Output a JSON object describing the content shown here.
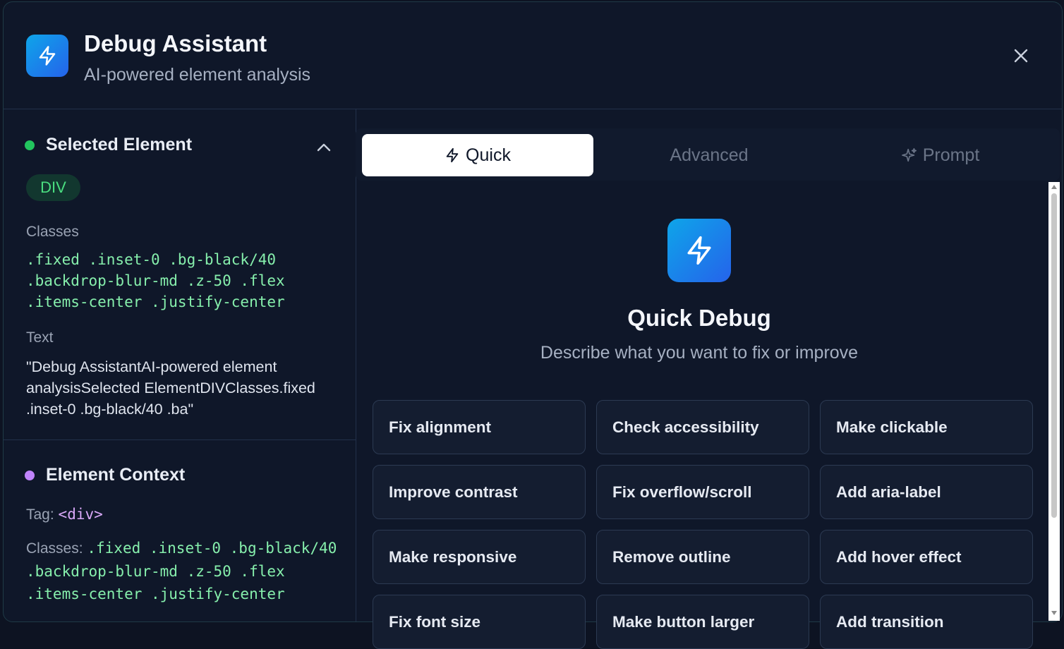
{
  "header": {
    "title": "Debug Assistant",
    "subtitle": "AI-powered element analysis",
    "icon": "lightning-icon",
    "close_icon": "close-icon"
  },
  "selected_element": {
    "title": "Selected Element",
    "dot_color": "#22c55e",
    "tag_badge": "DIV",
    "classes_label": "Classes",
    "classes": [
      ".fixed .inset-0 .bg-black/40",
      ".backdrop-blur-md .z-50 .flex",
      ".items-center .justify-center"
    ],
    "text_label": "Text",
    "text_value": "\"Debug AssistantAI-powered element analysisSelected ElementDIVClasses.fixed .inset-0 .bg-black/40 .ba\""
  },
  "element_context": {
    "title": "Element Context",
    "dot_color": "#c084fc",
    "tag_label": "Tag:",
    "tag_value": "<div>",
    "classes_label": "Classes:",
    "classes_first": ".fixed .inset-0 .bg-black/40",
    "classes_rest": [
      ".backdrop-blur-md .z-50 .flex",
      ".items-center .justify-center"
    ]
  },
  "tabs": [
    {
      "label": "Quick",
      "icon": "lightning-icon",
      "active": true
    },
    {
      "label": "Advanced",
      "active": false
    },
    {
      "label": "Prompt",
      "icon": "sparkle-icon",
      "active": false
    }
  ],
  "quick": {
    "title": "Quick Debug",
    "subtitle": "Describe what you want to fix or improve",
    "actions": [
      "Fix alignment",
      "Check accessibility",
      "Make clickable",
      "Improve contrast",
      "Fix overflow/scroll",
      "Add aria-label",
      "Make responsive",
      "Remove outline",
      "Add hover effect",
      "Fix font size",
      "Make button larger",
      "Add transition"
    ]
  },
  "colors": {
    "accent_gradient_start": "#0ea5e9",
    "accent_gradient_end": "#2563eb",
    "code_green": "#86efac",
    "tag_purple": "#d8a8f8"
  }
}
